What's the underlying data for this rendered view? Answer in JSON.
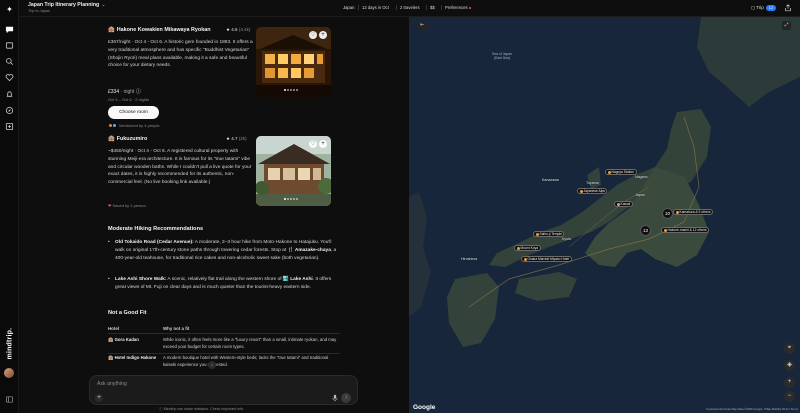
{
  "header": {
    "title": "Japan Trip Itinerary Planning",
    "subtitle": "Trip to Japan",
    "pills": [
      "Japan",
      "12 days in Oct",
      "2 travelers",
      "$$",
      "Preferences"
    ],
    "trip_label": "Trip",
    "trip_badge": "12"
  },
  "rail": {
    "brand": "mindtrip.",
    "icons": [
      "chat-icon",
      "folder-icon",
      "search-icon",
      "heart-icon",
      "bell-icon",
      "compass-icon",
      "add-square-icon"
    ]
  },
  "chat": {
    "hotel1": {
      "emoji": "🏨",
      "name": "Hakone Kowakien Mikawaya Ryokan",
      "rating": "4.6",
      "rating_count": "(4.4k)",
      "description": "£367/night · Oct 4 - Oct 6. A historic gem founded in 1883. It offers a very traditional atmosphere and has specific \"Buddhist Vegetarian\" (Shojin Ryori) meal plans available, making it a safe and beautiful choice for your dietary needs.",
      "price": "£334",
      "price_unit": "· night",
      "dates": "Oct 4 – Oct 6 · 2 nights",
      "button": "Choose room",
      "mentioned": "Mentioned by 4 people"
    },
    "hotel2": {
      "emoji": "🏨",
      "name": "Fukuzumiro",
      "rating": "4.7",
      "rating_count": "(2k)",
      "description": "~$450/night · Oct 4 - Oct 6. A registered cultural property with stunning Meiji-era architecture. It is famous for its \"true tatami\" vibe and circular wooden baths. While I couldn't pull a live quote for your exact dates, it is highly recommended for its authentic, non-commercial feel. (No live booking link available.)",
      "saved": "Saved by 1 person"
    },
    "hiking_heading": "Moderate Hiking Recommendations",
    "hike1": {
      "name": "Old Tokaido Road (Cedar Avenue):",
      "text1": " A moderate, 2–3 hour hike from Moto-Hakone to Hatajuku. You'll walk on original 17th-century stone paths through towering cedar forests. Stop at ",
      "emoji": "🍴",
      "place": "Amazake-chaya",
      "text2": ", a 400-year-old teahouse, for traditional rice cakes and non-alcoholic sweet sake (both vegetarian)."
    },
    "hike2": {
      "name": "Lake Ashi Shore Walk:",
      "text1": " A scenic, relatively flat trail along the western shore of ",
      "emoji": "🏞️",
      "place": "Lake Ashi",
      "text2": ". It offers great views of Mt. Fuji on clear days and is much quieter than the tourist-heavy eastern side."
    },
    "not_fit_heading": "Not a Good Fit",
    "table": {
      "col1": "Hotel",
      "col2": "Why not a fit",
      "rows": [
        {
          "emoji": "🏨",
          "hotel": "Gora Kadan",
          "reason": "While iconic, it often feels more like a \"luxury resort\" than a small, intimate ryokan, and may exceed your budget for certain room types."
        },
        {
          "emoji": "🏨",
          "hotel": "Hotel Indigo Hakone",
          "reason": "A modern boutique hotel with Western-style beds; lacks the \"true tatami\" and traditional kaiseki experience you requested."
        }
      ]
    },
    "input_placeholder": "Ask anything",
    "disclaimer": "Mindtrip can make mistakes. Check important info."
  },
  "map": {
    "sea_label": "Sea of Japan\n(East Sea)",
    "cities": [
      {
        "name": "Kanazawa"
      },
      {
        "name": "Toyama"
      },
      {
        "name": "Nagano"
      },
      {
        "name": "Japanese Alps"
      },
      {
        "name": "Hiroshima"
      },
      {
        "name": "Kyoto"
      },
      {
        "name": "Mount Koya"
      },
      {
        "name": "Osaka Marriott Miyako Hotel"
      },
      {
        "name": "Saiho-ji Temple"
      },
      {
        "name": "Nagoya Station"
      },
      {
        "name": "Kawaii"
      },
      {
        "name": "Kamakura & 9 others"
      },
      {
        "name": "Hakone-machi & 12 others"
      },
      {
        "name": "Japan"
      }
    ],
    "clusters": [
      "10",
      "13"
    ],
    "google": "Google",
    "attribution": "Keyboard shortcuts   Map Data ©2026 Google, TMap Mobility   50 km   Terms"
  }
}
